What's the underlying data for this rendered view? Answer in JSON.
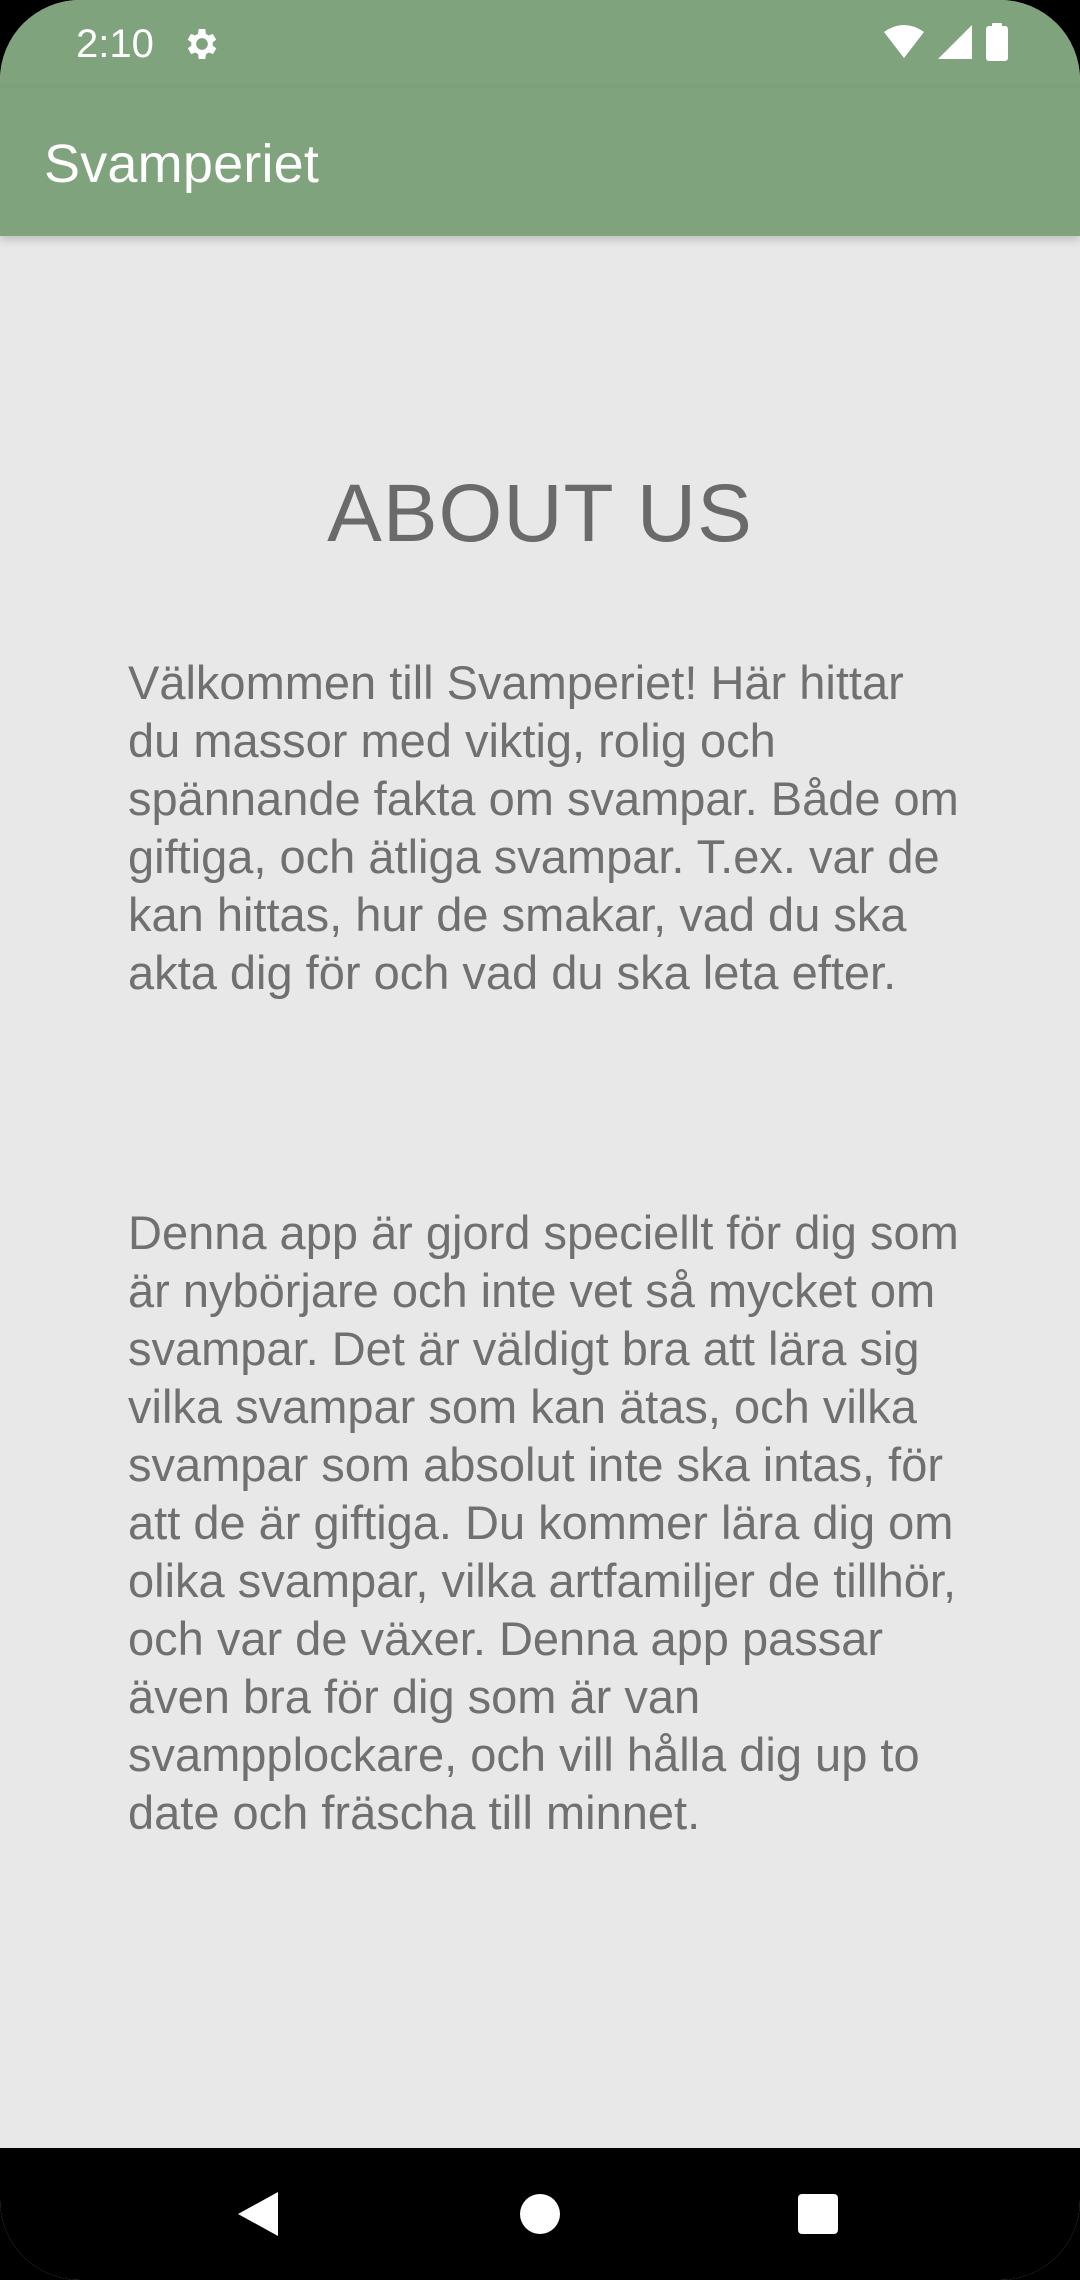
{
  "status_bar": {
    "time": "2:10",
    "icons": [
      "gear-icon",
      "wifi-icon",
      "signal-icon",
      "battery-icon"
    ]
  },
  "app_bar": {
    "title": "Svamperiet"
  },
  "main": {
    "heading": "ABOUT US",
    "paragraph_1": "Välkommen till Svamperiet! Här hittar du massor med viktig, rolig och spännande fakta om svampar. Både om giftiga, och ätliga svampar. T.ex. var de kan hittas, hur de smakar, vad du ska akta dig för och vad du ska leta efter.",
    "paragraph_2": "Denna app är gjord speciellt för dig som är nybörjare och inte vet så mycket om svampar. Det är väldigt bra att lära sig vilka svampar som kan ätas, och vilka svampar som absolut inte ska intas, för att de är giftiga. Du kommer lära dig om olika svampar, vilka artfamiljer de tillhör, och var de växer. Denna app passar även bra för dig som är van svampplockare, och vill hålla dig up to date och fräscha till minnet."
  },
  "nav_bar": {
    "buttons": [
      "back-icon",
      "home-icon",
      "recents-icon"
    ]
  },
  "colors": {
    "app_bar": "#7fa37d",
    "background": "#e8e8e8",
    "text": "#707070",
    "nav_bar": "#000000"
  }
}
